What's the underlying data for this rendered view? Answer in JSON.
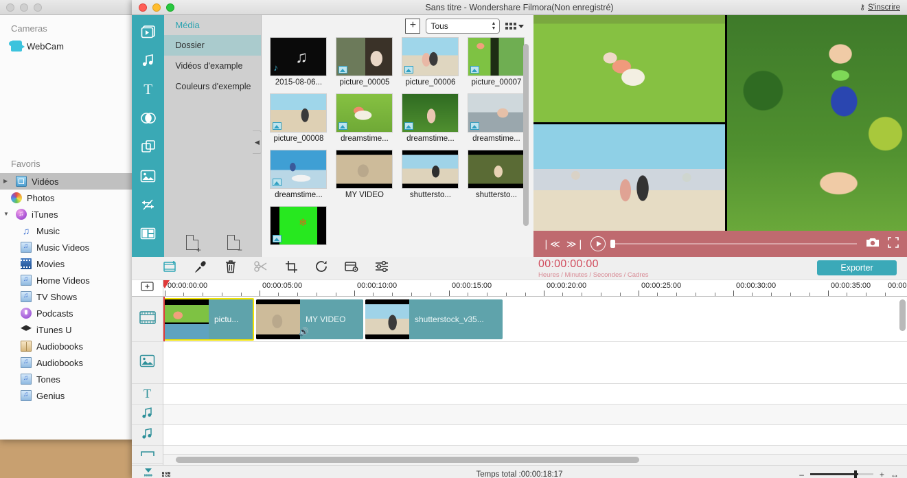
{
  "finder": {
    "sections": [
      {
        "title": "Cameras",
        "items": [
          {
            "label": "WebCam",
            "icon": "webcam-icon"
          }
        ]
      },
      {
        "title": "Favoris",
        "items": [
          {
            "label": "Vidéos",
            "icon": "videos-folder-icon",
            "selected": true,
            "disclosure": "▶"
          },
          {
            "label": "Photos",
            "icon": "photos-icon"
          },
          {
            "label": "iTunes",
            "icon": "itunes-icon",
            "disclosure": "▼"
          },
          {
            "label": "Music",
            "icon": "music-note-icon",
            "indent": true
          },
          {
            "label": "Music Videos",
            "icon": "music-video-icon",
            "indent": true
          },
          {
            "label": "Movies",
            "icon": "film-icon",
            "indent": true
          },
          {
            "label": "Home Videos",
            "icon": "music-video-icon",
            "indent": true
          },
          {
            "label": "TV Shows",
            "icon": "music-video-icon",
            "indent": true
          },
          {
            "label": "Podcasts",
            "icon": "podcast-icon",
            "indent": true
          },
          {
            "label": "iTunes U",
            "icon": "graduation-cap-icon",
            "indent": true
          },
          {
            "label": "Audiobooks",
            "icon": "book-icon",
            "indent": true
          },
          {
            "label": "Audiobooks",
            "icon": "music-video-icon",
            "indent": true
          },
          {
            "label": "Tones",
            "icon": "music-video-icon",
            "indent": true
          },
          {
            "label": "Genius",
            "icon": "music-video-icon",
            "indent": true
          }
        ]
      }
    ]
  },
  "window": {
    "title": "Sans titre - Wondershare Filmora(Non enregistré)",
    "signup_label": "S'inscrire",
    "key_icon": "⚷"
  },
  "rail": {
    "items": [
      {
        "name": "media-tool",
        "icon": "video-media-icon"
      },
      {
        "name": "audio-tool",
        "icon": "music-note-icon"
      },
      {
        "name": "text-tool",
        "icon": "text-t-icon"
      },
      {
        "name": "transition-tool",
        "icon": "overlapping-circles-icon"
      },
      {
        "name": "effects-tool",
        "icon": "overlapping-squares-icon"
      },
      {
        "name": "elements-tool",
        "icon": "picture-icon"
      },
      {
        "name": "split-tool",
        "icon": "arrows-swap-icon"
      },
      {
        "name": "splitscreen-tool",
        "icon": "split-screen-icon"
      }
    ]
  },
  "media_panel": {
    "header": "Média",
    "items": [
      {
        "label": "Dossier",
        "selected": true
      },
      {
        "label": "Vidéos d'example",
        "selected": false
      },
      {
        "label": "Couleurs d'exemple",
        "selected": false
      }
    ],
    "collapse_icon": "◀",
    "add_folder_icon": "file-plus-icon",
    "remove_folder_icon": "file-minus-icon"
  },
  "media_grid": {
    "add_button_label": "+",
    "filter_value": "Tous",
    "view_mode_icon": "grid-view-icon",
    "items": [
      {
        "caption": "2015-08-06...",
        "kind": "audio",
        "badge": false
      },
      {
        "caption": "picture_00005",
        "kind": "image",
        "badge": true
      },
      {
        "caption": "picture_00006",
        "kind": "image",
        "badge": true
      },
      {
        "caption": "picture_00007",
        "kind": "image",
        "badge": true
      },
      {
        "caption": "picture_00008",
        "kind": "image",
        "badge": true
      },
      {
        "caption": "dreamstime...",
        "kind": "image",
        "badge": true
      },
      {
        "caption": "dreamstime...",
        "kind": "image",
        "badge": true
      },
      {
        "caption": "dreamstime...",
        "kind": "image",
        "badge": true
      },
      {
        "caption": "dreamstime...",
        "kind": "image",
        "badge": true
      },
      {
        "caption": "MY VIDEO",
        "kind": "video",
        "badge": false
      },
      {
        "caption": "shuttersto...",
        "kind": "video",
        "badge": false
      },
      {
        "caption": "shuttersto...",
        "kind": "video",
        "badge": false
      },
      {
        "caption": "",
        "kind": "green",
        "badge": true
      }
    ]
  },
  "preview": {
    "controls": {
      "prev_icon": "❘≪",
      "next_icon": "≫❘",
      "play_icon": "play-icon",
      "snapshot_icon": "camera-icon",
      "fullscreen_icon": "fullscreen-icon"
    }
  },
  "timeline_toolbar": {
    "tools": [
      {
        "name": "add-media-button",
        "icon": "film-plus-icon"
      },
      {
        "name": "voiceover-button",
        "icon": "microphone-icon"
      },
      {
        "name": "delete-button",
        "icon": "trash-icon"
      },
      {
        "name": "split-button",
        "icon": "scissors-icon",
        "disabled": true
      },
      {
        "name": "crop-button",
        "icon": "crop-icon"
      },
      {
        "name": "rotate-button",
        "icon": "rotate-icon"
      },
      {
        "name": "speed-button",
        "icon": "speed-settings-icon"
      },
      {
        "name": "adjust-button",
        "icon": "sliders-icon"
      }
    ],
    "timecode": "00:00:00:00",
    "timecode_units": "Heures / Minutes / Secondes / Cadres",
    "export_label": "Exporter"
  },
  "ruler": {
    "labels": [
      "00:00:00:00",
      "00:00:05:00",
      "00:00:10:00",
      "00:00:15:00",
      "00:00:20:00",
      "00:00:25:00",
      "00:00:30:00",
      "00:00:35:00",
      "00:00:"
    ],
    "add_track_icon": "add-track-icon"
  },
  "tracks": {
    "heads": [
      {
        "name": "video-track-head",
        "icon": "film-strip-icon"
      },
      {
        "name": "image-track-head",
        "icon": "picture-icon"
      },
      {
        "name": "text-track-head",
        "icon": "text-t-icon"
      },
      {
        "name": "audio-track-head-1",
        "icon": "music-note-icon"
      },
      {
        "name": "audio-track-head-2",
        "icon": "music-note-icon"
      },
      {
        "name": "voice-track-head",
        "icon": "audio-curve-icon"
      },
      {
        "name": "expand-tracks",
        "icon": "chevron-down-icon"
      }
    ],
    "clips": [
      {
        "label": "pictu...",
        "selected": true,
        "has_audio": false
      },
      {
        "label": "MY VIDEO",
        "selected": false,
        "has_audio": true
      },
      {
        "label": "shutterstock_v35...",
        "selected": false,
        "has_audio": false
      }
    ]
  },
  "status_bar": {
    "total_time": "Temps total :00:00:18:17",
    "grid_icon": "grid-view-icon",
    "marker_icon": "marker-icon",
    "zoom_out": "–",
    "zoom_in": "+",
    "fit_icon": "↔"
  },
  "colors": {
    "teal": "#3aa9b5",
    "clip_teal": "#5fa3ab",
    "accent_red": "#d14b5c",
    "player_bar": "#bf6a6f",
    "selection_yellow": "#f2e300"
  }
}
